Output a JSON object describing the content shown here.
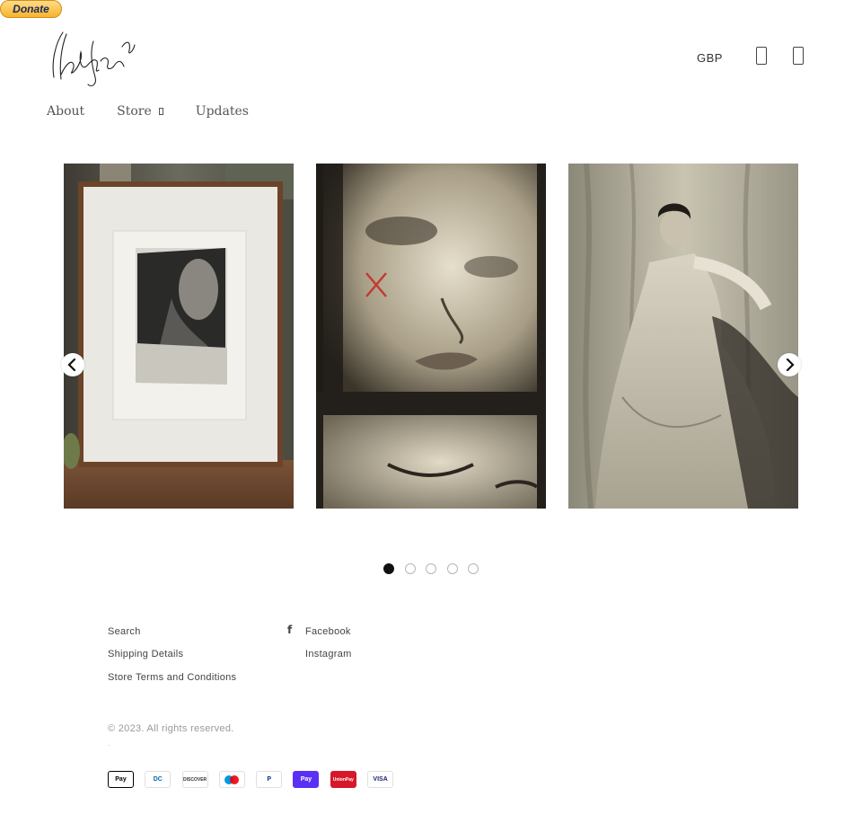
{
  "donate_label": "Donate",
  "logo_alt": "Ollie Rogers signature logo",
  "header": {
    "currency": "GBP",
    "search_icon": "search-icon",
    "cart_icon": "cart-icon"
  },
  "nav": {
    "about": "About",
    "store": "Store",
    "updates": "Updates"
  },
  "carousel": {
    "slides": [
      {
        "description": "Framed black-and-white portrait on wooden shelf"
      },
      {
        "description": "Film-strip close-up of a woman's face with red X mark"
      },
      {
        "description": "Sepia portrait of a seated woman in a white dress"
      }
    ],
    "dot_count": 5,
    "active_index": 0
  },
  "footer": {
    "links_left": [
      "Search",
      "Shipping Details",
      "Store Terms and Conditions"
    ],
    "links_right": [
      "Facebook",
      "Instagram"
    ],
    "copyright": "© 2023. All rights reserved.",
    "copyright_dot": "."
  },
  "payments": [
    {
      "label": "Pay",
      "icon": "apple-pay-icon",
      "bg": "#ffffff",
      "fg": "#000000",
      "border": "#000000"
    },
    {
      "label": "DC",
      "icon": "diners-club-icon",
      "bg": "#ffffff",
      "fg": "#0069aa",
      "border": "#e0e0e0"
    },
    {
      "label": "DISCOVER",
      "icon": "discover-icon",
      "bg": "#ffffff",
      "fg": "#333333",
      "border": "#e0e0e0"
    },
    {
      "label": "",
      "icon": "maestro-icon",
      "bg": "#ffffff",
      "fg": "#cc0000",
      "border": "#e0e0e0"
    },
    {
      "label": "P",
      "icon": "paypal-icon",
      "bg": "#ffffff",
      "fg": "#003087",
      "border": "#e0e0e0"
    },
    {
      "label": "Pay",
      "icon": "shop-pay-icon",
      "bg": "#5a31f4",
      "fg": "#ffffff",
      "border": "#5a31f4"
    },
    {
      "label": "UnionPay",
      "icon": "unionpay-icon",
      "bg": "#d6182a",
      "fg": "#ffffff",
      "border": "#d6182a"
    },
    {
      "label": "VISA",
      "icon": "visa-icon",
      "bg": "#ffffff",
      "fg": "#1a1f71",
      "border": "#e0e0e0"
    }
  ]
}
